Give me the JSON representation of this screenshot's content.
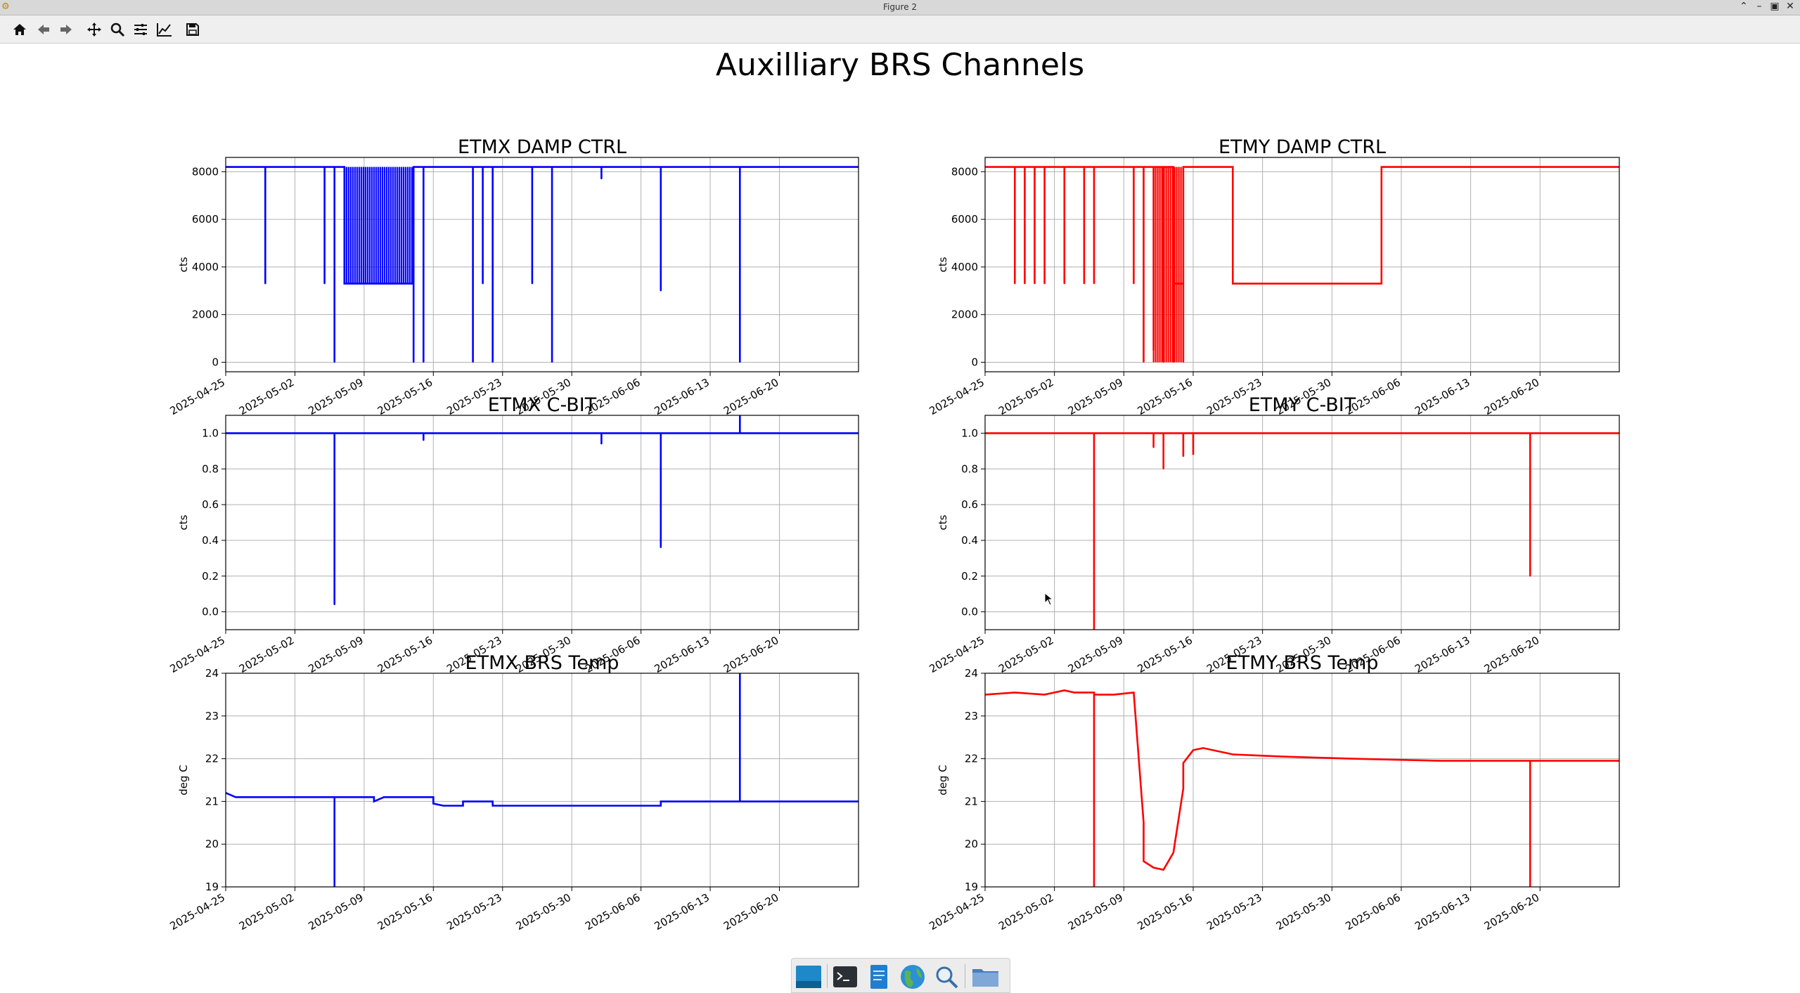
{
  "window": {
    "title": "Figure 2",
    "app_icon": "matplotlib-icon",
    "controls": [
      "minimize-icon",
      "maximize-icon",
      "restore-icon",
      "close-icon"
    ]
  },
  "toolbar": {
    "buttons": [
      "home-icon",
      "back-icon",
      "forward-icon",
      "pan-icon",
      "zoom-icon",
      "configure-subplots-icon",
      "edit-axis-icon",
      "save-icon"
    ]
  },
  "figure": {
    "suptitle": "Auxilliary BRS Channels"
  },
  "colors": {
    "etmx": "#0000ff",
    "etmy": "#ff0000",
    "grid": "#b0b0b0"
  },
  "x_ticks": [
    "2025-04-25",
    "2025-05-02",
    "2025-05-09",
    "2025-05-16",
    "2025-05-23",
    "2025-05-30",
    "2025-06-06",
    "2025-06-13",
    "2025-06-20"
  ],
  "chart_data": [
    {
      "type": "line",
      "title": "ETMX DAMP CTRL",
      "ylabel": "cts",
      "color": "#0000ff",
      "xlim": [
        "2025-04-25",
        "2025-06-28"
      ],
      "ylim": [
        -400,
        8600
      ],
      "yticks": [
        0,
        2000,
        4000,
        6000,
        8000
      ],
      "ytick_labels": [
        "0",
        "2000",
        "4000",
        "6000",
        "8000"
      ],
      "grid": true,
      "series": [
        {
          "x": [
            "2025-04-25",
            "2025-04-29",
            "2025-04-29",
            "2025-04-29",
            "2025-04-29",
            "2025-05-05",
            "2025-05-05",
            "2025-05-05",
            "2025-05-06",
            "2025-05-06",
            "2025-05-06",
            "2025-05-06",
            "2025-05-07",
            "2025-05-07",
            "2025-05-07",
            "2025-05-14",
            "2025-05-14",
            "2025-05-14",
            "2025-05-14",
            "2025-05-14",
            "2025-05-15",
            "2025-05-15",
            "2025-05-15",
            "2025-05-20",
            "2025-05-20",
            "2025-05-20",
            "2025-05-21",
            "2025-05-21",
            "2025-05-21",
            "2025-05-22",
            "2025-05-22",
            "2025-05-22",
            "2025-05-26",
            "2025-05-26",
            "2025-05-26",
            "2025-05-28",
            "2025-05-28",
            "2025-05-28",
            "2025-06-02",
            "2025-06-02",
            "2025-06-02",
            "2025-06-08",
            "2025-06-08",
            "2025-06-08",
            "2025-06-16",
            "2025-06-16",
            "2025-06-16",
            "2025-06-28"
          ],
          "y": [
            8200,
            8200,
            3300,
            3300,
            8200,
            8200,
            3300,
            8200,
            8200,
            0,
            3300,
            8200,
            8200,
            3300,
            3300,
            3300,
            8200,
            0,
            0,
            8200,
            8200,
            0,
            8200,
            8200,
            0,
            8200,
            8200,
            3300,
            8200,
            8200,
            0,
            8200,
            8200,
            3300,
            8200,
            8200,
            0,
            8200,
            8200,
            7700,
            8200,
            8200,
            3000,
            8200,
            8200,
            0,
            8200,
            8200
          ]
        }
      ],
      "notes_dense_band": {
        "from": "2025-05-07",
        "to": "2025-05-14",
        "low": 3300,
        "high": 8200
      }
    },
    {
      "type": "line",
      "title": "ETMY DAMP CTRL",
      "ylabel": "cts",
      "color": "#ff0000",
      "xlim": [
        "2025-04-25",
        "2025-06-28"
      ],
      "ylim": [
        -400,
        8600
      ],
      "yticks": [
        0,
        2000,
        4000,
        6000,
        8000
      ],
      "ytick_labels": [
        "0",
        "2000",
        "4000",
        "6000",
        "8000"
      ],
      "grid": true,
      "series": [
        {
          "x": [
            "2025-04-25",
            "2025-04-28",
            "2025-04-28",
            "2025-04-28",
            "2025-04-29",
            "2025-04-29",
            "2025-04-29",
            "2025-04-30",
            "2025-04-30",
            "2025-04-30",
            "2025-05-01",
            "2025-05-01",
            "2025-05-01",
            "2025-05-03",
            "2025-05-03",
            "2025-05-03",
            "2025-05-05",
            "2025-05-05",
            "2025-05-05",
            "2025-05-06",
            "2025-05-06",
            "2025-05-06",
            "2025-05-10",
            "2025-05-10",
            "2025-05-10",
            "2025-05-11",
            "2025-05-11",
            "2025-05-11",
            "2025-05-12",
            "2025-05-12",
            "2025-05-12",
            "2025-05-13",
            "2025-05-13",
            "2025-05-13",
            "2025-05-14",
            "2025-05-14",
            "2025-05-14",
            "2025-05-15",
            "2025-05-15",
            "2025-05-15",
            "2025-05-16",
            "2025-05-16",
            "2025-05-20",
            "2025-05-20",
            "2025-06-04",
            "2025-06-04",
            "2025-06-28"
          ],
          "y": [
            8200,
            8200,
            3300,
            8200,
            8200,
            3300,
            8200,
            8200,
            3300,
            8200,
            8200,
            3300,
            8200,
            8200,
            3300,
            8200,
            8200,
            3300,
            8200,
            8200,
            3300,
            8200,
            8200,
            3300,
            8200,
            8200,
            0,
            8200,
            8200,
            500,
            8200,
            8200,
            0,
            8200,
            8200,
            0,
            3300,
            3300,
            0,
            8200,
            8200,
            8200,
            8200,
            3300,
            3300,
            8200,
            8200
          ]
        }
      ],
      "notes_dense_band": {
        "from": "2025-05-12",
        "to": "2025-05-15",
        "low": 0,
        "high": 8200
      }
    },
    {
      "type": "line",
      "title": "ETMX C-BIT",
      "ylabel": "cts",
      "color": "#0000ff",
      "xlim": [
        "2025-04-25",
        "2025-06-28"
      ],
      "ylim": [
        -0.1,
        1.1
      ],
      "yticks": [
        0,
        0.2,
        0.4,
        0.6,
        0.8,
        1.0
      ],
      "ytick_labels": [
        "0.0",
        "0.2",
        "0.4",
        "0.6",
        "0.8",
        "1.0"
      ],
      "grid": true,
      "series": [
        {
          "x": [
            "2025-04-25",
            "2025-05-06",
            "2025-05-06",
            "2025-05-06",
            "2025-05-15",
            "2025-05-15",
            "2025-05-15",
            "2025-06-02",
            "2025-06-02",
            "2025-06-02",
            "2025-06-08",
            "2025-06-08",
            "2025-06-08",
            "2025-06-16",
            "2025-06-16",
            "2025-06-16",
            "2025-06-28"
          ],
          "y": [
            1.0,
            1.0,
            0.04,
            1.0,
            1.0,
            0.96,
            1.0,
            1.0,
            0.94,
            1.0,
            1.0,
            0.36,
            1.0,
            1.0,
            1.1,
            1.0,
            1.0
          ]
        }
      ]
    },
    {
      "type": "line",
      "title": "ETMY C-BIT",
      "ylabel": "cts",
      "color": "#ff0000",
      "xlim": [
        "2025-04-25",
        "2025-06-28"
      ],
      "ylim": [
        -0.1,
        1.1
      ],
      "yticks": [
        0,
        0.2,
        0.4,
        0.6,
        0.8,
        1.0
      ],
      "ytick_labels": [
        "0.0",
        "0.2",
        "0.4",
        "0.6",
        "0.8",
        "1.0"
      ],
      "grid": true,
      "series": [
        {
          "x": [
            "2025-04-25",
            "2025-05-06",
            "2025-05-06",
            "2025-05-06",
            "2025-05-12",
            "2025-05-12",
            "2025-05-12",
            "2025-05-13",
            "2025-05-13",
            "2025-05-13",
            "2025-05-15",
            "2025-05-15",
            "2025-05-15",
            "2025-05-16",
            "2025-05-16",
            "2025-05-16",
            "2025-06-19",
            "2025-06-19",
            "2025-06-19",
            "2025-06-28"
          ],
          "y": [
            1.0,
            1.0,
            -0.1,
            1.0,
            1.0,
            0.92,
            1.0,
            1.0,
            0.8,
            1.0,
            1.0,
            0.87,
            1.0,
            1.0,
            0.88,
            1.0,
            1.0,
            0.2,
            1.0,
            1.0
          ]
        }
      ]
    },
    {
      "type": "line",
      "title": "ETMX BRS Temp",
      "ylabel": "deg C",
      "color": "#0000ff",
      "xlim": [
        "2025-04-25",
        "2025-06-28"
      ],
      "ylim": [
        19,
        24
      ],
      "yticks": [
        19,
        20,
        21,
        22,
        23,
        24
      ],
      "ytick_labels": [
        "19",
        "20",
        "21",
        "22",
        "23",
        "24"
      ],
      "grid": true,
      "series": [
        {
          "x": [
            "2025-04-25",
            "2025-04-26",
            "2025-04-27",
            "2025-05-06",
            "2025-05-06",
            "2025-05-06",
            "2025-05-10",
            "2025-05-10",
            "2025-05-11",
            "2025-05-16",
            "2025-05-16",
            "2025-05-17",
            "2025-05-19",
            "2025-05-19",
            "2025-05-20",
            "2025-05-22",
            "2025-05-22",
            "2025-05-23",
            "2025-05-25",
            "2025-05-25",
            "2025-05-26",
            "2025-06-07",
            "2025-06-08",
            "2025-06-08",
            "2025-06-16",
            "2025-06-16",
            "2025-06-16",
            "2025-06-17",
            "2025-06-17",
            "2025-06-28"
          ],
          "y": [
            21.2,
            21.1,
            21.1,
            21.1,
            19.0,
            21.1,
            21.1,
            21.0,
            21.1,
            21.1,
            20.95,
            20.9,
            20.9,
            21.0,
            21.0,
            21.0,
            20.9,
            20.9,
            20.9,
            20.9,
            20.9,
            20.9,
            20.9,
            21.0,
            21.0,
            24.0,
            21.0,
            21.0,
            21.0,
            21.0
          ]
        }
      ]
    },
    {
      "type": "line",
      "title": "ETMY BRS Temp",
      "ylabel": "deg C",
      "color": "#ff0000",
      "xlim": [
        "2025-04-25",
        "2025-06-28"
      ],
      "ylim": [
        19,
        24
      ],
      "yticks": [
        19,
        20,
        21,
        22,
        23,
        24
      ],
      "ytick_labels": [
        "19",
        "20",
        "21",
        "22",
        "23",
        "24"
      ],
      "grid": true,
      "series": [
        {
          "x": [
            "2025-04-25",
            "2025-04-28",
            "2025-05-01",
            "2025-05-03",
            "2025-05-04",
            "2025-05-06",
            "2025-05-06",
            "2025-05-06",
            "2025-05-08",
            "2025-05-10",
            "2025-05-11",
            "2025-05-11",
            "2025-05-12",
            "2025-05-13",
            "2025-05-14",
            "2025-05-15",
            "2025-05-15",
            "2025-05-16",
            "2025-05-17",
            "2025-05-20",
            "2025-05-25",
            "2025-06-01",
            "2025-06-10",
            "2025-06-19",
            "2025-06-19",
            "2025-06-19",
            "2025-06-28"
          ],
          "y": [
            23.5,
            23.55,
            23.5,
            23.6,
            23.55,
            23.55,
            19.0,
            23.5,
            23.5,
            23.55,
            20.5,
            19.6,
            19.45,
            19.4,
            19.8,
            21.3,
            21.9,
            22.2,
            22.25,
            22.1,
            22.05,
            22.0,
            21.95,
            21.95,
            19.0,
            21.95,
            21.95
          ]
        }
      ]
    }
  ]
}
